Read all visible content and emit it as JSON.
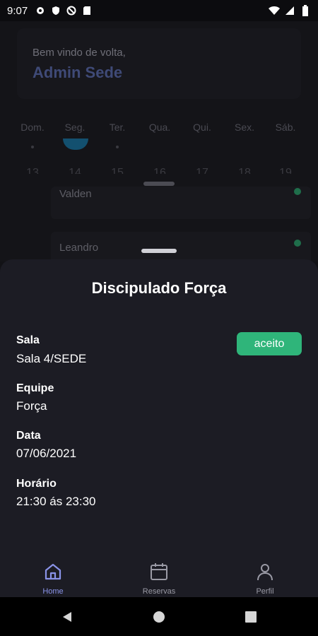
{
  "status_bar": {
    "time": "9:07"
  },
  "background": {
    "greeting": "Bem vindo de volta,",
    "user_name": "Admin Sede",
    "weekdays": [
      "Dom.",
      "Seg.",
      "Ter.",
      "Qua.",
      "Qui.",
      "Sex.",
      "Sáb."
    ],
    "day_numbers": [
      "13",
      "14",
      "15",
      "16",
      "17",
      "18",
      "19"
    ],
    "list_items": [
      "Valden",
      "Leandro"
    ]
  },
  "sheet": {
    "title": "Discipulado Força",
    "status_badge": "aceito",
    "fields": [
      {
        "label": "Sala",
        "value": "Sala 4/SEDE"
      },
      {
        "label": "Equipe",
        "value": "Força"
      },
      {
        "label": "Data",
        "value": "07/06/2021"
      },
      {
        "label": "Horário",
        "value": "21:30 ás 23:30"
      }
    ]
  },
  "tabs": [
    {
      "label": "Home",
      "icon": "home-icon",
      "active": true
    },
    {
      "label": "Reservas",
      "icon": "calendar-icon",
      "active": false
    },
    {
      "label": "Perfil",
      "icon": "person-icon",
      "active": false
    }
  ],
  "colors": {
    "accent": "#8a93e8",
    "badge": "#2fb57a",
    "sheet_bg": "#1c1c24"
  }
}
